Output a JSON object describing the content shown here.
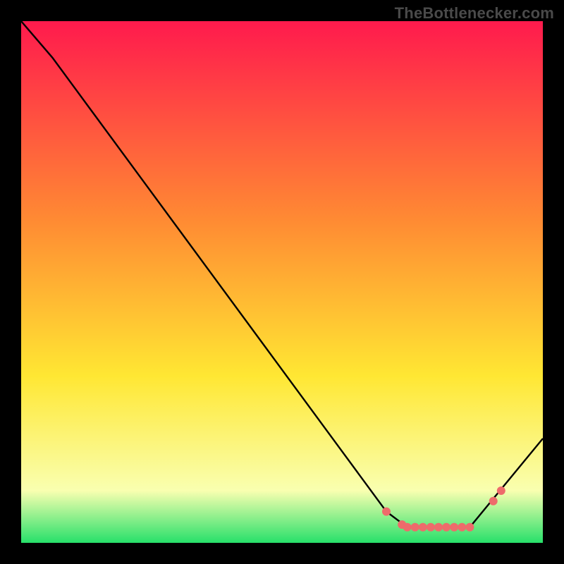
{
  "attribution": "TheBottlenecker.com",
  "colors": {
    "bg": "#000000",
    "line": "#000000",
    "marker": "#ee6b6b",
    "grad_top": "#ff1a4d",
    "grad_mid1": "#ff8a33",
    "grad_mid2": "#ffe733",
    "grad_low": "#f9ffb0",
    "grad_bottom": "#27e06a"
  },
  "chart_data": {
    "type": "line",
    "title": "",
    "xlabel": "",
    "ylabel": "",
    "xlim": [
      0,
      100
    ],
    "ylim": [
      0,
      100
    ],
    "series": [
      {
        "name": "curve",
        "x": [
          0,
          6,
          70,
          74,
          86,
          100
        ],
        "y": [
          100,
          93,
          6,
          3,
          3,
          20
        ]
      }
    ],
    "markers": {
      "name": "highlight-dots",
      "x": [
        70,
        73,
        74,
        75.5,
        77,
        78.5,
        80,
        81.5,
        83,
        84.5,
        86,
        90.5,
        92
      ],
      "y": [
        6,
        3.5,
        3,
        3,
        3,
        3,
        3,
        3,
        3,
        3,
        3,
        8,
        10
      ]
    }
  }
}
